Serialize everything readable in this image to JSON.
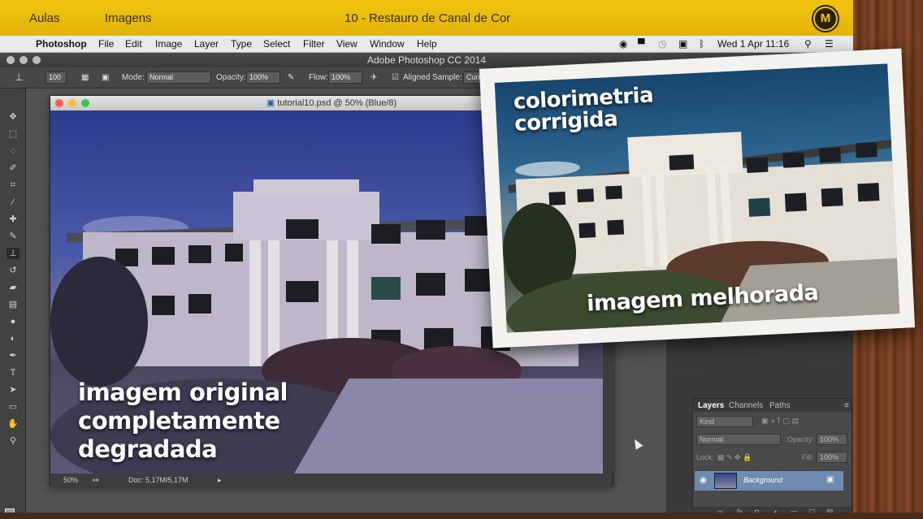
{
  "banner": {
    "nav": [
      "Aulas",
      "Imagens"
    ],
    "title": "10 - Restauro de Canal de Cor"
  },
  "menubar": {
    "app": "Photoshop",
    "items": [
      "File",
      "Edit",
      "Image",
      "Layer",
      "Type",
      "Select",
      "Filter",
      "View",
      "Window",
      "Help"
    ],
    "clock": "Wed 1 Apr  11:16"
  },
  "ps": {
    "window_title": "Adobe Photoshop CC 2014",
    "options": {
      "brush_size": "100",
      "mode_label": "Mode:",
      "mode_value": "Normal",
      "opacity_label": "Opacity:",
      "opacity_value": "100%",
      "flow_label": "Flow:",
      "flow_value": "100%",
      "aligned_label": "Aligned",
      "sample_label": "Sample:",
      "sample_value": "Curre"
    },
    "document": {
      "title": "tutorial10.psd @ 50% (Blue/8)",
      "zoom": "50%",
      "doc_info": "Doc: 5,17M/5,17M"
    },
    "layers_panel": {
      "tabs": [
        "Layers",
        "Channels",
        "Paths"
      ],
      "kind": "Kind",
      "blend": "Normal",
      "opacity_label": "Opacity:",
      "opacity_value": "100%",
      "lock_label": "Lock:",
      "fill_label": "Fill:",
      "fill_value": "100%",
      "layer_name": "Background"
    }
  },
  "overlays": {
    "original_line1": "imagem original",
    "original_line2": "completamente",
    "original_line3": "degradada",
    "corrected_line1": "colorimetria",
    "corrected_line2": "corrigida",
    "improved": "imagem melhorada"
  },
  "colors": {
    "banner": "#f1c40f",
    "original_sky": "#2d3b8e",
    "corrected_sky": "#17466d"
  }
}
